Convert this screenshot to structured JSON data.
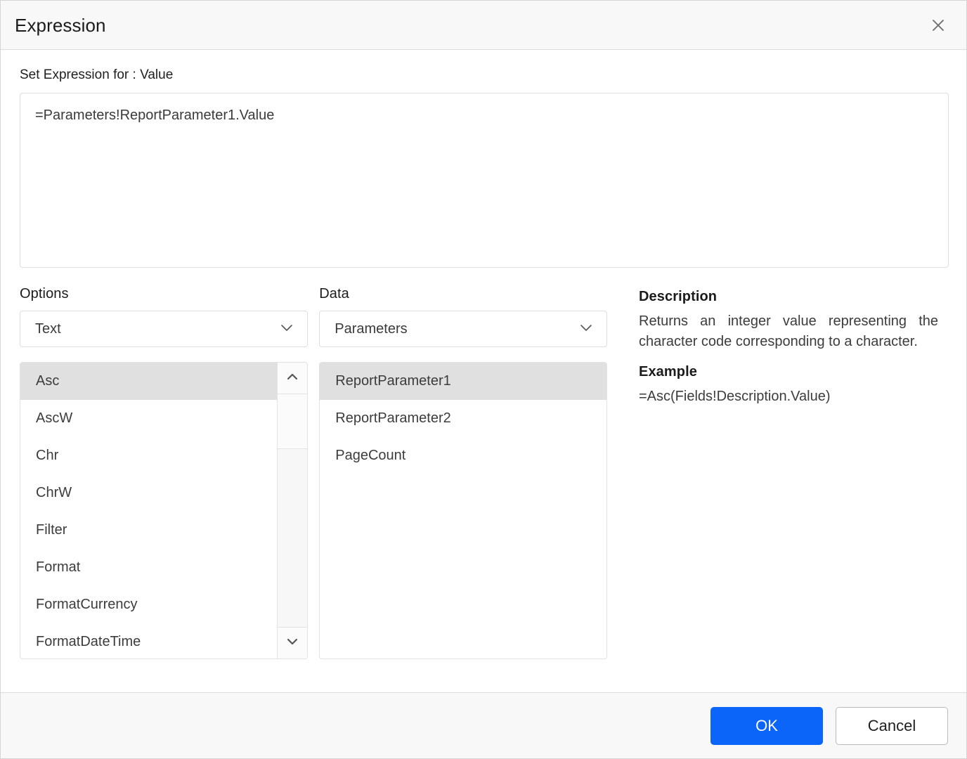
{
  "dialog": {
    "title": "Expression",
    "close_icon": "close-icon"
  },
  "expression": {
    "label": "Set Expression for : Value",
    "value": "=Parameters!ReportParameter1.Value",
    "placeholder": ""
  },
  "options_panel": {
    "title": "Options",
    "category_select": {
      "value": "Text",
      "chevron_icon": "chevron-down-icon"
    },
    "items": [
      {
        "label": "Asc",
        "selected": true
      },
      {
        "label": "AscW",
        "selected": false
      },
      {
        "label": "Chr",
        "selected": false
      },
      {
        "label": "ChrW",
        "selected": false
      },
      {
        "label": "Filter",
        "selected": false
      },
      {
        "label": "Format",
        "selected": false
      },
      {
        "label": "FormatCurrency",
        "selected": false
      },
      {
        "label": "FormatDateTime",
        "selected": false
      }
    ],
    "scrollbar": {
      "up_icon": "chevron-up-icon",
      "down_icon": "chevron-down-icon"
    }
  },
  "data_panel": {
    "title": "Data",
    "category_select": {
      "value": "Parameters",
      "chevron_icon": "chevron-down-icon"
    },
    "items": [
      {
        "label": "ReportParameter1",
        "selected": true
      },
      {
        "label": "ReportParameter2",
        "selected": false
      },
      {
        "label": "PageCount",
        "selected": false
      }
    ]
  },
  "description_panel": {
    "description_heading": "Description",
    "description_text": "Returns an integer value representing the character code corresponding to a character.",
    "example_heading": "Example",
    "example_text": "=Asc(Fields!Description.Value)"
  },
  "footer": {
    "ok_label": "OK",
    "cancel_label": "Cancel"
  },
  "colors": {
    "accent": "#0a65f8",
    "header_bg": "#f8f8f8",
    "selection_bg": "#e0e0e0",
    "border": "#dedede"
  }
}
